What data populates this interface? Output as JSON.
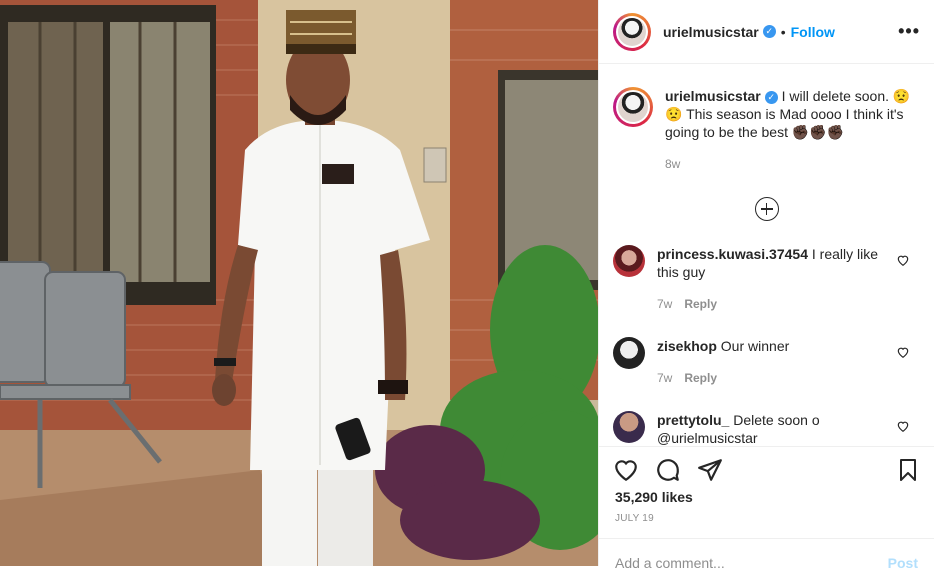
{
  "header": {
    "username": "urielmusicstar",
    "separator": "•",
    "follow_label": "Follow",
    "more_label": "•••"
  },
  "caption": {
    "username": "urielmusicstar",
    "text": "I will delete soon. 😟😟 This season is Mad oooo I think it's going to be the best ✊🏿✊🏿✊🏿",
    "age": "8w"
  },
  "comments": [
    {
      "username": "princess.kuwasi.37454",
      "text": "I really like this guy",
      "age": "7w",
      "reply_label": "Reply"
    },
    {
      "username": "zisekhop",
      "text": "Our winner",
      "age": "7w",
      "reply_label": "Reply"
    },
    {
      "username": "prettytolu_",
      "text": "Delete soon o @urielmusicstar",
      "age": "",
      "reply_label": ""
    }
  ],
  "likes": "35,290 likes",
  "date": "JULY 19",
  "add_comment": {
    "placeholder": "Add a comment...",
    "post_label": "Post"
  },
  "colors": {
    "accent": "#0095f6",
    "muted": "#8e8e8e",
    "text": "#262626"
  }
}
